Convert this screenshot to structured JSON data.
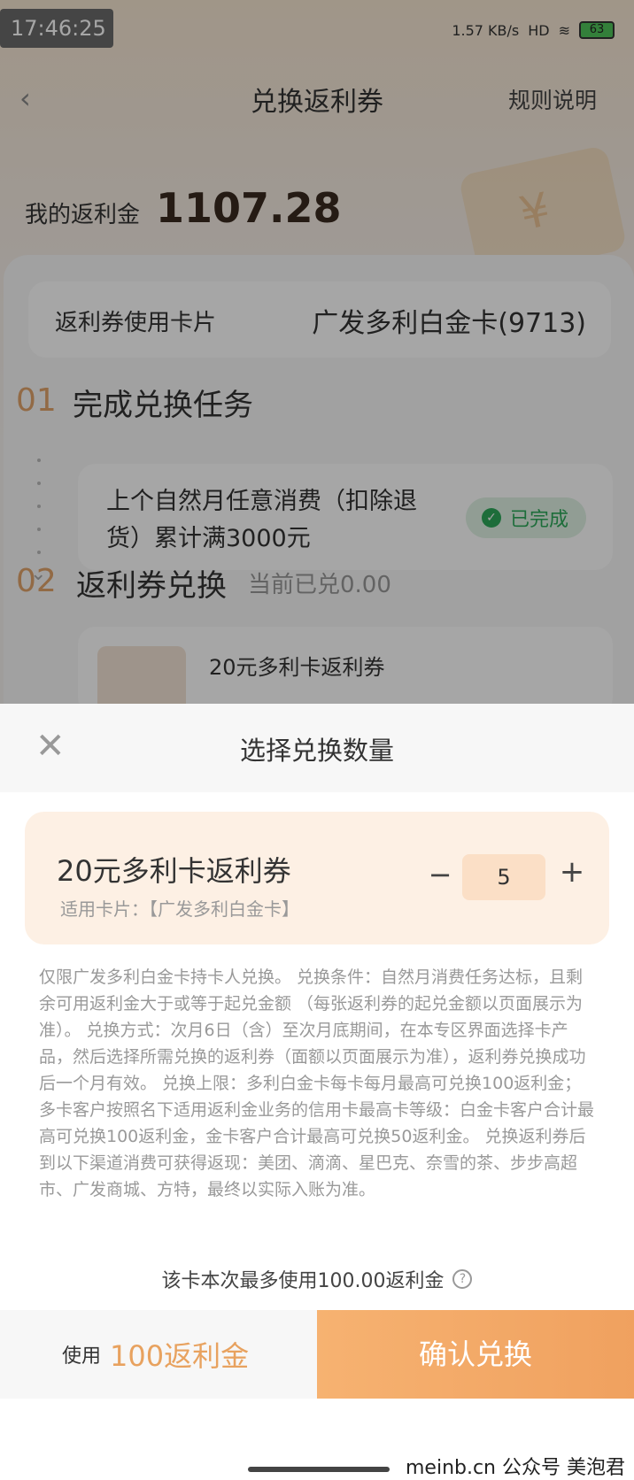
{
  "status": {
    "time": "17:46:25",
    "net_speed": "1.57 KB/s",
    "signal": "HD",
    "battery": "63"
  },
  "nav": {
    "title": "兑换返利券",
    "rules": "规则说明"
  },
  "balance": {
    "label": "我的返利金",
    "value": "1107.28"
  },
  "card_row": {
    "label": "返利券使用卡片",
    "value": "广发多利白金卡(9713)"
  },
  "step1": {
    "num": "01",
    "title": "完成兑换任务",
    "task": "上个自然月任意消费（扣除退货）累计满3000元",
    "status": "已完成"
  },
  "step2": {
    "num": "02",
    "title": "返利券兑换",
    "sub": "当前已兑0.00",
    "coupon_preview": "20元多利卡返利券"
  },
  "sheet": {
    "title": "选择兑换数量",
    "coupon_name": "20元多利卡返利券",
    "card_label": "适用卡片：【广发多利白金卡】",
    "quantity": "5",
    "minus": "−",
    "plus": "+",
    "terms": "仅限广发多利白金卡持卡人兑换。 兑换条件：自然月消费任务达标，且剩余可用返利金大于或等于起兑金额 （每张返利券的起兑金额以页面展示为准）。 兑换方式：次月6日（含）至次月底期间，在本专区界面选择卡产品，然后选择所需兑换的返利券（面额以页面展示为准），返利券兑换成功后一个月有效。 兑换上限：多利白金卡每卡每月最高可兑换100返利金；多卡客户按照名下适用返利金业务的信用卡最高卡等级：白金卡客户合计最高可兑换100返利金，金卡客户合计最高可兑换50返利金。 兑换返利券后到以下渠道消费可获得返现：美团、滴滴、星巴克、奈雪的茶、步步高超市、广发商城、方特，最终以实际入账为准。",
    "max_usage": "该卡本次最多使用100.00返利金",
    "use_prefix": "使用",
    "use_amount": "100返利金",
    "confirm": "确认兑换"
  },
  "watermark": "meinb.cn  公众号 美泡君"
}
